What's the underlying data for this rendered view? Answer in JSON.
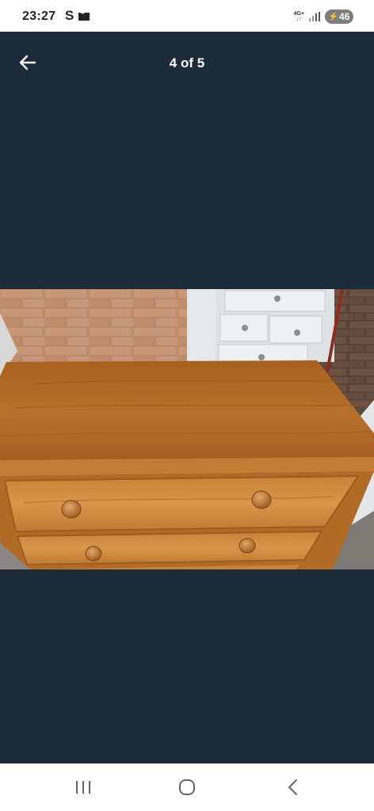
{
  "status_bar": {
    "time": "23:27",
    "carrier_glyph": "S",
    "mail_icon": "mail-icon",
    "network_type": "4G+",
    "battery_level": "46"
  },
  "viewer": {
    "position_label": "4 of 5",
    "back_icon": "arrow-left-icon"
  },
  "photo": {
    "subject_icon": "chest-of-drawers-photo"
  },
  "nav_bar": {
    "recents_icon": "recents-icon",
    "home_icon": "home-icon",
    "back_icon": "back-chevron-icon"
  },
  "colors": {
    "background": "#1c2b3a",
    "status_bar": "#ffffff",
    "pine": "#b36a2a"
  }
}
